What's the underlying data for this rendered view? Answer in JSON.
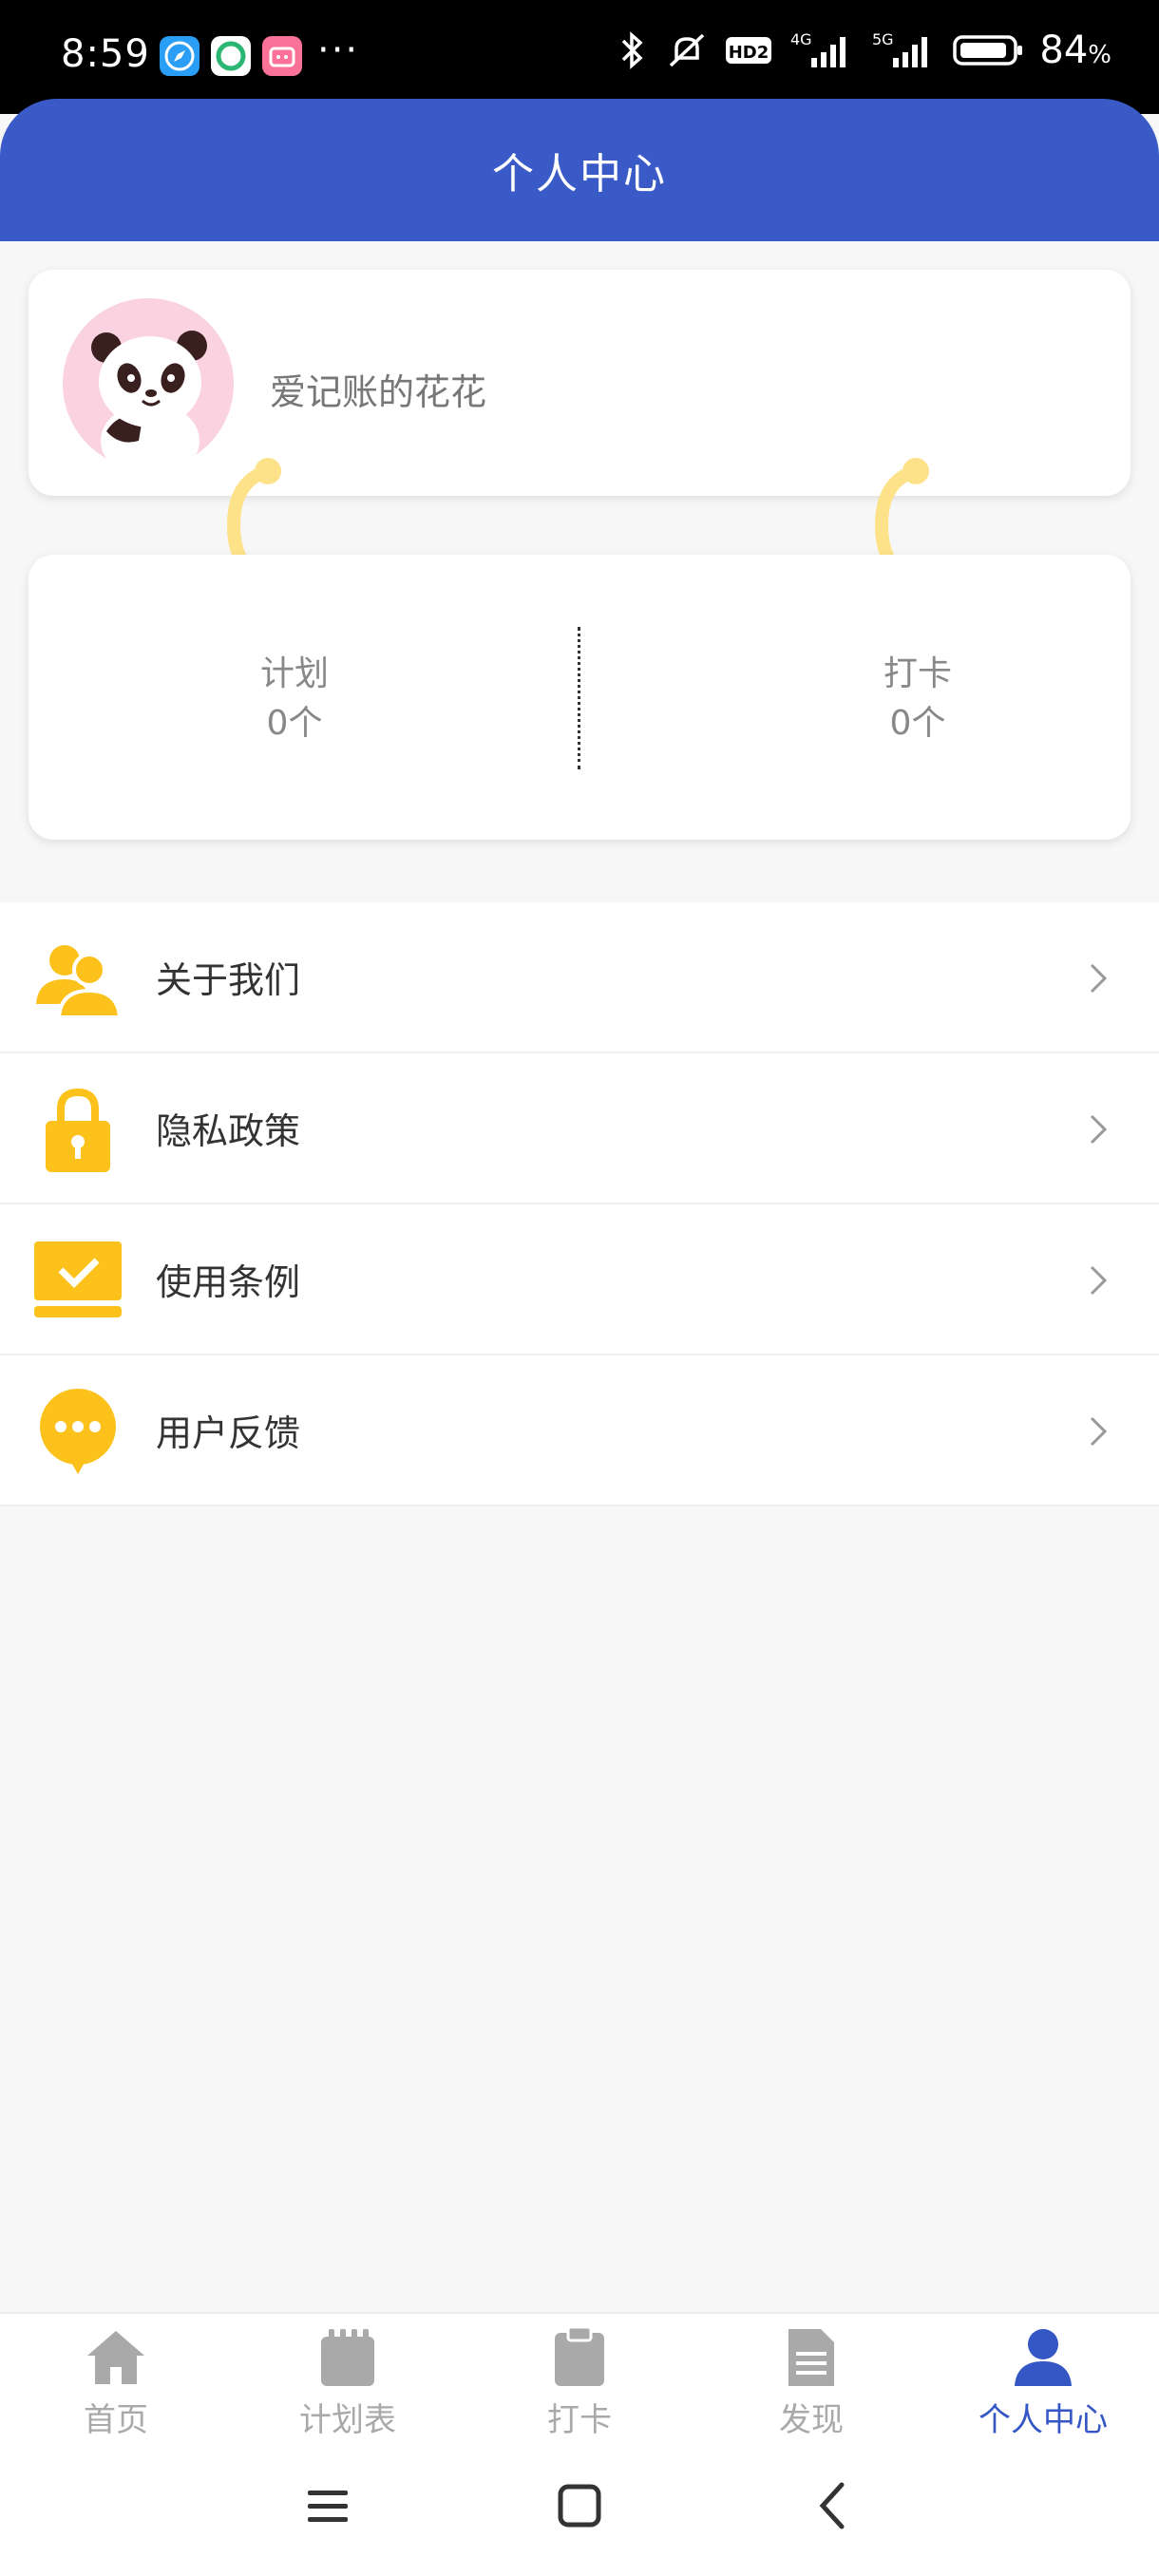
{
  "status_bar": {
    "time": "8:59",
    "battery_value": "84",
    "battery_unit": "%",
    "more": "···"
  },
  "header": {
    "title": "个人中心"
  },
  "profile": {
    "username": "爱记账的花花"
  },
  "stats": [
    {
      "label": "计划",
      "value": "0个"
    },
    {
      "label": "打卡",
      "value": "0个"
    }
  ],
  "menu": [
    {
      "label": "关于我们",
      "icon": "users-icon"
    },
    {
      "label": "隐私政策",
      "icon": "lock-icon"
    },
    {
      "label": "使用条例",
      "icon": "laptop-check-icon"
    },
    {
      "label": "用户反馈",
      "icon": "chat-bubble-icon"
    }
  ],
  "tabs": [
    {
      "label": "首页",
      "icon": "home-icon",
      "active": false
    },
    {
      "label": "计划表",
      "icon": "calendar-icon",
      "active": false
    },
    {
      "label": "打卡",
      "icon": "clipboard-icon",
      "active": false
    },
    {
      "label": "发现",
      "icon": "document-icon",
      "active": false
    },
    {
      "label": "个人中心",
      "icon": "person-icon",
      "active": true
    }
  ],
  "colors": {
    "header": "#3a5bc7",
    "accent_yellow": "#fcc21b",
    "tab_active": "#3556c5",
    "tab_inactive": "#a9a9a9"
  }
}
